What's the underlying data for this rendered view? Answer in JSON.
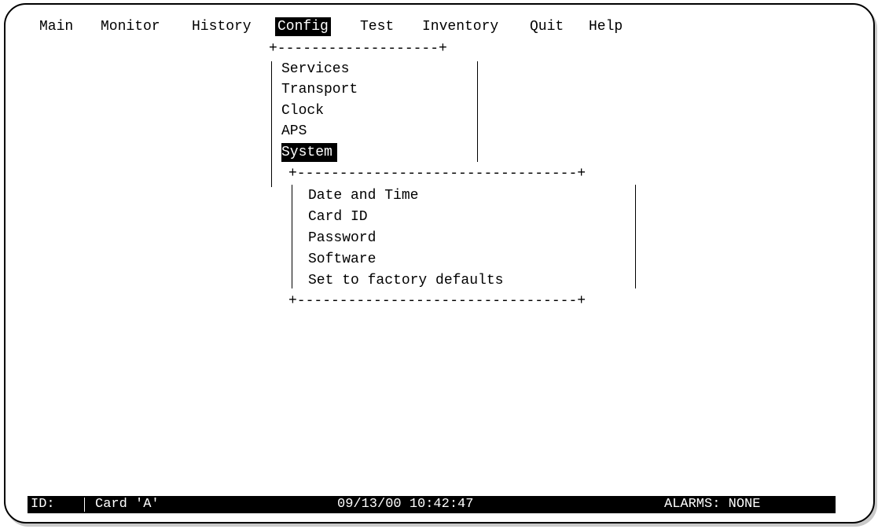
{
  "menubar": {
    "items": [
      {
        "label": "Main"
      },
      {
        "label": "Monitor"
      },
      {
        "label": "History"
      },
      {
        "label": "Config"
      },
      {
        "label": "Test"
      },
      {
        "label": "Inventory"
      },
      {
        "label": "Quit"
      },
      {
        "label": "Help"
      }
    ],
    "selected": "Config"
  },
  "config_menu": {
    "border": "+-------------------+",
    "items": [
      {
        "label": "Services"
      },
      {
        "label": "Transport"
      },
      {
        "label": "Clock"
      },
      {
        "label": "APS"
      },
      {
        "label": "System"
      }
    ],
    "selected": "System"
  },
  "system_submenu": {
    "border": "+---------------------------------+",
    "items": [
      {
        "label": "Date and Time"
      },
      {
        "label": "Card ID"
      },
      {
        "label": "Password"
      },
      {
        "label": "Software"
      },
      {
        "label": "Set to factory defaults"
      }
    ]
  },
  "statusbar": {
    "id_label": "ID:",
    "card": "Card 'A'",
    "datetime": "09/13/00 10:42:47",
    "alarms": "ALARMS: NONE"
  },
  "colors": {
    "foreground": "#000000",
    "background": "#ffffff",
    "highlight_bg": "#000000",
    "highlight_fg": "#ffffff"
  }
}
